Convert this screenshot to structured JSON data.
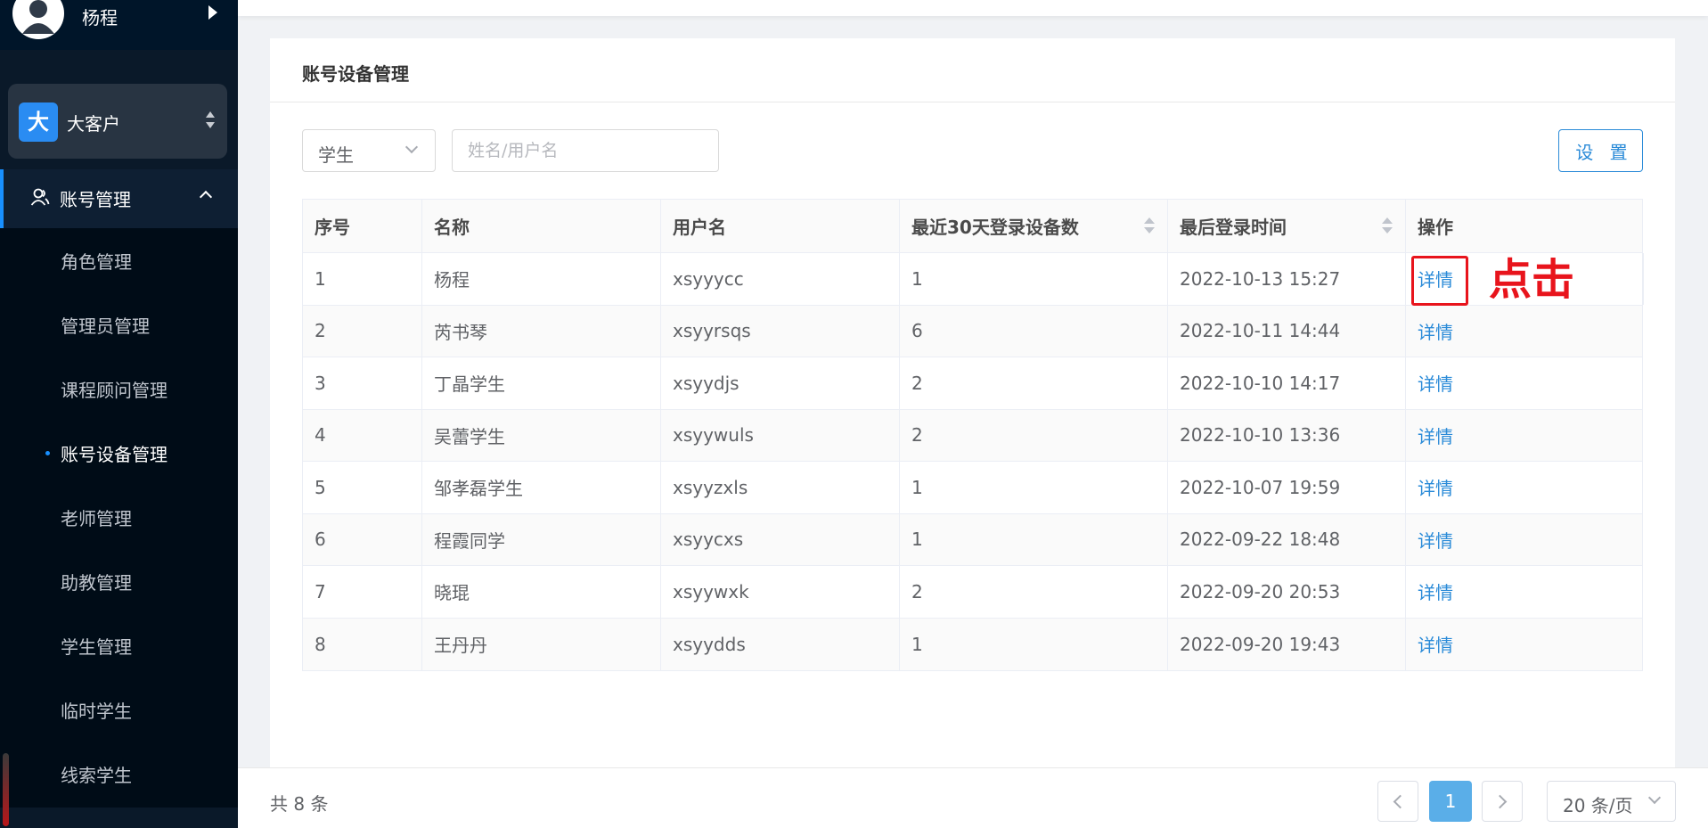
{
  "user": {
    "name": "杨程"
  },
  "tenant": {
    "badge": "大",
    "name": "大客户"
  },
  "menu": {
    "parent_label": "账号管理",
    "items": [
      {
        "label": "角色管理",
        "active": false
      },
      {
        "label": "管理员管理",
        "active": false
      },
      {
        "label": "课程顾问管理",
        "active": false
      },
      {
        "label": "账号设备管理",
        "active": true
      },
      {
        "label": "老师管理",
        "active": false
      },
      {
        "label": "助教管理",
        "active": false
      },
      {
        "label": "学生管理",
        "active": false
      },
      {
        "label": "临时学生",
        "active": false
      },
      {
        "label": "线索学生",
        "active": false
      }
    ]
  },
  "page": {
    "title": "账号设备管理",
    "filter_select_value": "学生",
    "search_placeholder": "姓名/用户名",
    "settings_label": "设 置"
  },
  "table": {
    "columns": [
      "序号",
      "名称",
      "用户名",
      "最近30天登录设备数",
      "最后登录时间",
      "操作"
    ],
    "rows": [
      {
        "index": "1",
        "name": "杨程",
        "username": "xsyyycc",
        "devices": "1",
        "last_login": "2022-10-13 15:27",
        "action": "详情"
      },
      {
        "index": "2",
        "name": "芮书琴",
        "username": "xsyyrsqs",
        "devices": "6",
        "last_login": "2022-10-11 14:44",
        "action": "详情"
      },
      {
        "index": "3",
        "name": "丁晶学生",
        "username": "xsyydjs",
        "devices": "2",
        "last_login": "2022-10-10 14:17",
        "action": "详情"
      },
      {
        "index": "4",
        "name": "吴蕾学生",
        "username": "xsyywuls",
        "devices": "2",
        "last_login": "2022-10-10 13:36",
        "action": "详情"
      },
      {
        "index": "5",
        "name": "邹孝磊学生",
        "username": "xsyyzxls",
        "devices": "1",
        "last_login": "2022-10-07 19:59",
        "action": "详情"
      },
      {
        "index": "6",
        "name": "程霞同学",
        "username": "xsyycxs",
        "devices": "1",
        "last_login": "2022-09-22 18:48",
        "action": "详情"
      },
      {
        "index": "7",
        "name": "晓琨",
        "username": "xsyywxk",
        "devices": "2",
        "last_login": "2022-09-20 20:53",
        "action": "详情"
      },
      {
        "index": "8",
        "name": "王丹丹",
        "username": "xsyydds",
        "devices": "1",
        "last_login": "2022-09-20 19:43",
        "action": "详情"
      }
    ]
  },
  "annotation": {
    "text": "点击",
    "color": "#e8141c"
  },
  "pagination": {
    "total": "共 8 条",
    "current_page": "1",
    "page_size": "20 条/页"
  },
  "colors": {
    "accent": "#2b8bd8",
    "sidebar_bg": "#0a1929",
    "active_page": "#5aaee8"
  }
}
